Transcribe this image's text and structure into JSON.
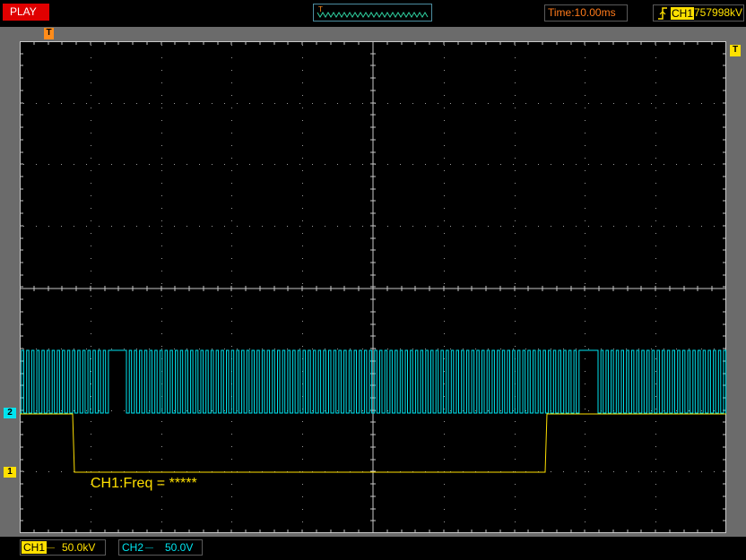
{
  "toolbar": {
    "play_label": "PLAY",
    "time_label": "Time:10.00ms",
    "trigger_channel": "CH1",
    "trigger_level": "757998kV"
  },
  "markers": {
    "trigger_top": "T",
    "trigger_right": "T",
    "ch1": "1",
    "ch2": "2"
  },
  "readout": {
    "text": "CH1:Freq = *****"
  },
  "status": {
    "ch1_label": "CH1",
    "ch1_coupling": "—",
    "ch1_scale": "50.0kV",
    "ch2_label": "CH2",
    "ch2_coupling": "—",
    "ch2_scale": "50.0V"
  },
  "colors": {
    "ch1": "#ffe000",
    "ch2": "#00e5f0",
    "trigger": "#ff8c1a",
    "grid": "#c8c8c8",
    "play": "#e00000"
  },
  "icons": {
    "trigger_edge": "rising-edge-icon",
    "coupling": "dc-coupling-icon"
  }
}
